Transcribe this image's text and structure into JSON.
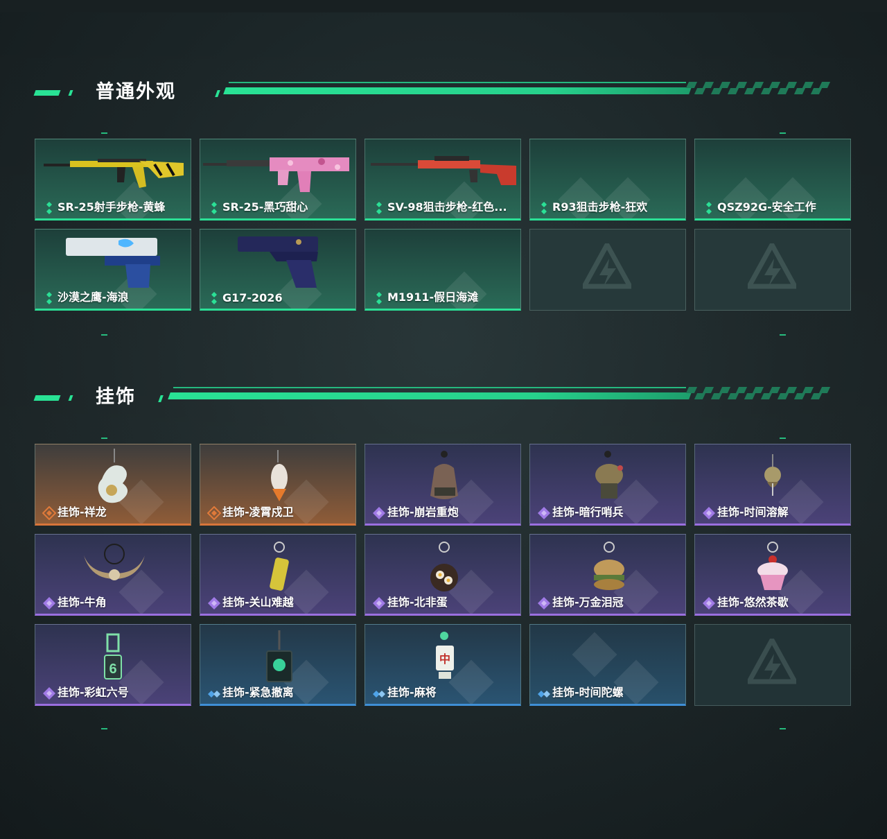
{
  "sections": {
    "skins": {
      "title": "普通外观",
      "items": [
        {
          "label": "SR-25射手步枪-黄蜂",
          "icon": "rifle-yellow-icon"
        },
        {
          "label": "SR-25-黑巧甜心",
          "icon": "rifle-pink-icon"
        },
        {
          "label": "SV-98狙击步枪-红色...",
          "icon": "sniper-red-icon"
        },
        {
          "label": "R93狙击步枪-狂欢",
          "icon": "placeholder-diamond-icon"
        },
        {
          "label": "QSZ92G-安全工作",
          "icon": "placeholder-diamond-icon"
        },
        {
          "label": "沙漠之鹰-海浪",
          "icon": "pistol-deagle-icon"
        },
        {
          "label": "G17-2026",
          "icon": "pistol-glock-icon"
        },
        {
          "label": "M1911-假日海滩",
          "icon": "placeholder-diamond-icon"
        }
      ]
    },
    "charms": {
      "title": "挂饰",
      "items": [
        {
          "label": "挂饰-祥龙",
          "rarity": "orange",
          "icon": "dragon-charm-icon"
        },
        {
          "label": "挂饰-凌霄戍卫",
          "rarity": "orange",
          "icon": "rocket-charm-icon"
        },
        {
          "label": "挂饰-崩岩重炮",
          "rarity": "purple",
          "icon": "rock-charm-icon"
        },
        {
          "label": "挂饰-暗行哨兵",
          "rarity": "purple",
          "icon": "sentinel-charm-icon"
        },
        {
          "label": "挂饰-时间溶解",
          "rarity": "purple",
          "icon": "melting-clock-charm-icon"
        },
        {
          "label": "挂饰-牛角",
          "rarity": "purple",
          "icon": "bull-horn-charm-icon"
        },
        {
          "label": "挂饰-关山难越",
          "rarity": "purple",
          "icon": "yellow-can-charm-icon"
        },
        {
          "label": "挂饰-北非蛋",
          "rarity": "purple",
          "icon": "shakshuka-charm-icon"
        },
        {
          "label": "挂饰-万金泪冠",
          "rarity": "purple",
          "icon": "burger-charm-icon"
        },
        {
          "label": "挂饰-悠然茶歇",
          "rarity": "purple",
          "icon": "cupcake-charm-icon"
        },
        {
          "label": "挂饰-彩虹六号",
          "rarity": "purple",
          "icon": "rainbow-six-charm-icon"
        },
        {
          "label": "挂饰-紧急撤离",
          "rarity": "blue",
          "icon": "evac-cube-charm-icon"
        },
        {
          "label": "挂饰-麻将",
          "rarity": "blue",
          "icon": "mahjong-charm-icon"
        },
        {
          "label": "挂饰-时间陀螺",
          "rarity": "blue",
          "icon": "placeholder-diamond-icon"
        }
      ]
    }
  },
  "colors": {
    "accent_green": "#29e295",
    "rarity_orange": "#d8753a",
    "rarity_purple": "#9b6fe0",
    "rarity_blue": "#3f8fd6"
  }
}
